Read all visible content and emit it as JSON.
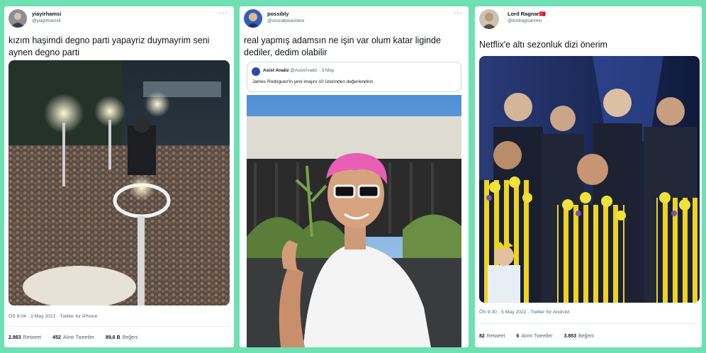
{
  "tweets": [
    {
      "name": "yiayirhamsi",
      "handle": "@yiayirhamsii",
      "text": "kızım haşimdi degno parti yapayriz duymayrim seni aynen degno parti",
      "meta": "ÖS 8:04 · 2 May 2022 · Twitter for iPhone",
      "stats": {
        "retweets": "2.863",
        "retweets_label": "Retweet",
        "quotes": "452",
        "quotes_label": "Alıntı Tweetler",
        "likes": "89,6 B",
        "likes_label": "Beğeni"
      }
    },
    {
      "name": "possibly",
      "handle": "@onsralpwashere",
      "text": "real yapmış adamsın ne işin var olum katar liginde dediler, dedim olabilir",
      "quote": {
        "name": "Asist Analiz",
        "handle": "@AsistAnaliz · 3 May",
        "text": "James Rodriguez'in yeni imajını 10 üzerinden değerlendirin."
      }
    },
    {
      "name": "Lord Ragnar",
      "flag": "🇹🇷",
      "handle": "@lordragnarinho",
      "text": "Netflix'e altı sezonluk dizi önerim",
      "meta": "ÖS 9:30 · 5 May 2022 · Twitter for Android",
      "stats": {
        "retweets": "82",
        "retweets_label": "Retweet",
        "quotes": "6",
        "quotes_label": "Alıntı Tweetler",
        "likes": "3.853",
        "likes_label": "Beğeni"
      }
    }
  ],
  "more_glyph": "···",
  "colors": {
    "background": "#6fe0b4",
    "card": "#ffffff",
    "text": "#0f1419",
    "muted": "#536471"
  }
}
